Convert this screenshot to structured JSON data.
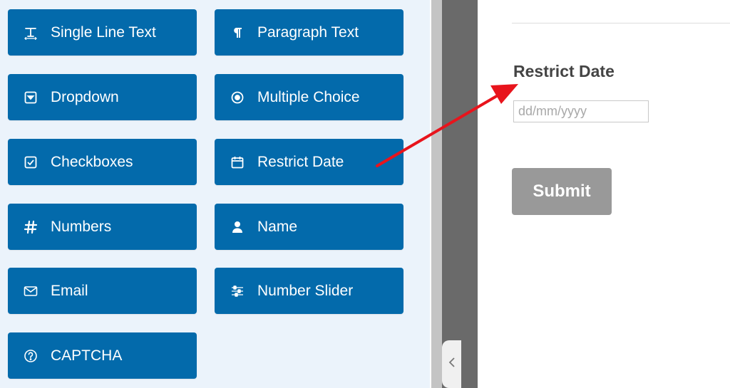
{
  "fields": [
    {
      "label": "Single Line Text",
      "icon": "text-cursor-icon"
    },
    {
      "label": "Paragraph Text",
      "icon": "pilcrow-icon"
    },
    {
      "label": "Dropdown",
      "icon": "dropdown-icon"
    },
    {
      "label": "Multiple Choice",
      "icon": "radio-icon"
    },
    {
      "label": "Checkboxes",
      "icon": "checkbox-icon"
    },
    {
      "label": "Restrict Date",
      "icon": "calendar-icon"
    },
    {
      "label": "Numbers",
      "icon": "hash-icon"
    },
    {
      "label": "Name",
      "icon": "user-icon"
    },
    {
      "label": "Email",
      "icon": "envelope-icon"
    },
    {
      "label": "Number Slider",
      "icon": "sliders-icon"
    },
    {
      "label": "CAPTCHA",
      "icon": "question-circle-icon"
    }
  ],
  "preview": {
    "field_label": "Restrict Date",
    "date_placeholder": "dd/mm/yyyy",
    "submit_label": "Submit"
  },
  "collapse_icon": "chevron-left-icon",
  "colors": {
    "button_bg": "#036aab",
    "panel_bg": "#ebf3fb",
    "arrow": "#e8141c",
    "submit_bg": "#999999"
  }
}
